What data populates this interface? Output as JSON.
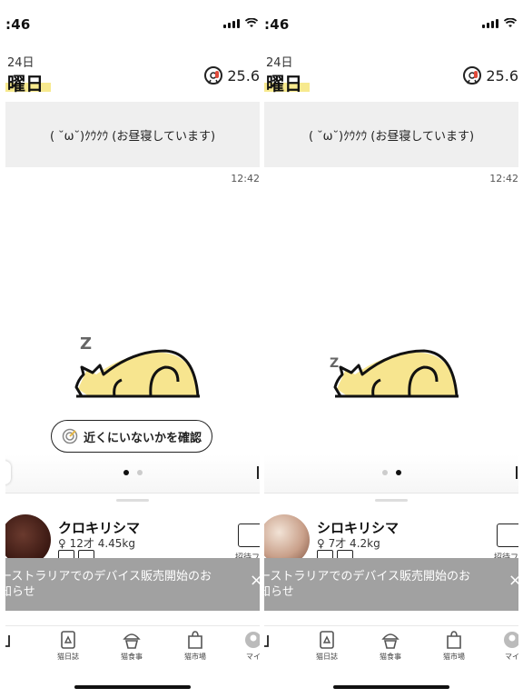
{
  "screens": [
    {
      "status_time": ":46",
      "date_day": "24日",
      "date_weekday": "曜日",
      "temperature": "25.6",
      "message": "( ˘ω˘)ｸｳｸｳ (お昼寝しています)",
      "message_time": "12:42",
      "confirm_button": "近くにいないかを確認",
      "z_label": "Z",
      "active_page": 1,
      "pet_name": "クロキリシマ",
      "pet_info": "♀ 12才 4.45kg",
      "invite_label": "招待フ",
      "notice": "ーストラリアでのデバイス販売開始のお\n知らせ",
      "notice_close": "×",
      "tabs": [
        "",
        "猫日誌",
        "猫食事",
        "猫市場",
        "マイ"
      ]
    },
    {
      "status_time": ":46",
      "date_day": "24日",
      "date_weekday": "曜日",
      "temperature": "25.6",
      "message": "( ˘ω˘)ｸｳｸｳ (お昼寝しています)",
      "message_time": "12:42",
      "confirm_button": "",
      "z_label": "Z",
      "active_page": 2,
      "pet_name": "シロキリシマ",
      "pet_info": "♀ 7才 4.2kg",
      "invite_label": "招待フ",
      "notice": "ーストラリアでのデバイス販売開始のお\n知らせ",
      "notice_close": "×",
      "tabs": [
        "",
        "猫日誌",
        "猫食事",
        "猫市場",
        "マイ"
      ]
    }
  ],
  "colors": {
    "cat_fill": "#f7e58f",
    "highlight": "#f7e98e",
    "notice_bg": "#a1a1a1",
    "message_bg": "#efefef"
  },
  "icons": {
    "temperature": "thermometer-icon",
    "confirm": "radar-icon",
    "tab_diary": "diary-icon",
    "tab_food": "food-bowl-icon",
    "tab_market": "shopping-bag-icon",
    "tab_my": "profile-icon"
  }
}
